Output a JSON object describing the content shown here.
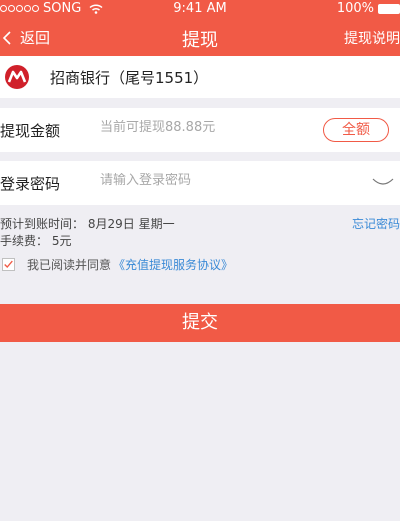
{
  "status_bar": {
    "carrier": "SONG",
    "time": "9:41 AM",
    "battery": "100%"
  },
  "nav": {
    "back_label": "返回",
    "title": "提现",
    "right_label": "提现说明"
  },
  "bank": {
    "name": "招商银行（尾号1551）"
  },
  "withdraw_amount": {
    "label": "提现金额",
    "placeholder": "当前可提现88.88元",
    "all_button": "全额"
  },
  "login_password": {
    "label": "登录密码",
    "placeholder": "请输入登录密码"
  },
  "info": {
    "arrival_label": "预计到账时间：",
    "arrival_value": "8月29日  星期一",
    "fee_label": "手续费：",
    "fee_value": "5元",
    "forgot_password": "忘记密码"
  },
  "agreement": {
    "checked": true,
    "text": "我已阅读并同意",
    "link": "《充值提现服务协议》"
  },
  "submit_label": "提交",
  "colors": {
    "accent": "#f15a46",
    "link": "#3a8ad6",
    "background": "#efeef3"
  }
}
